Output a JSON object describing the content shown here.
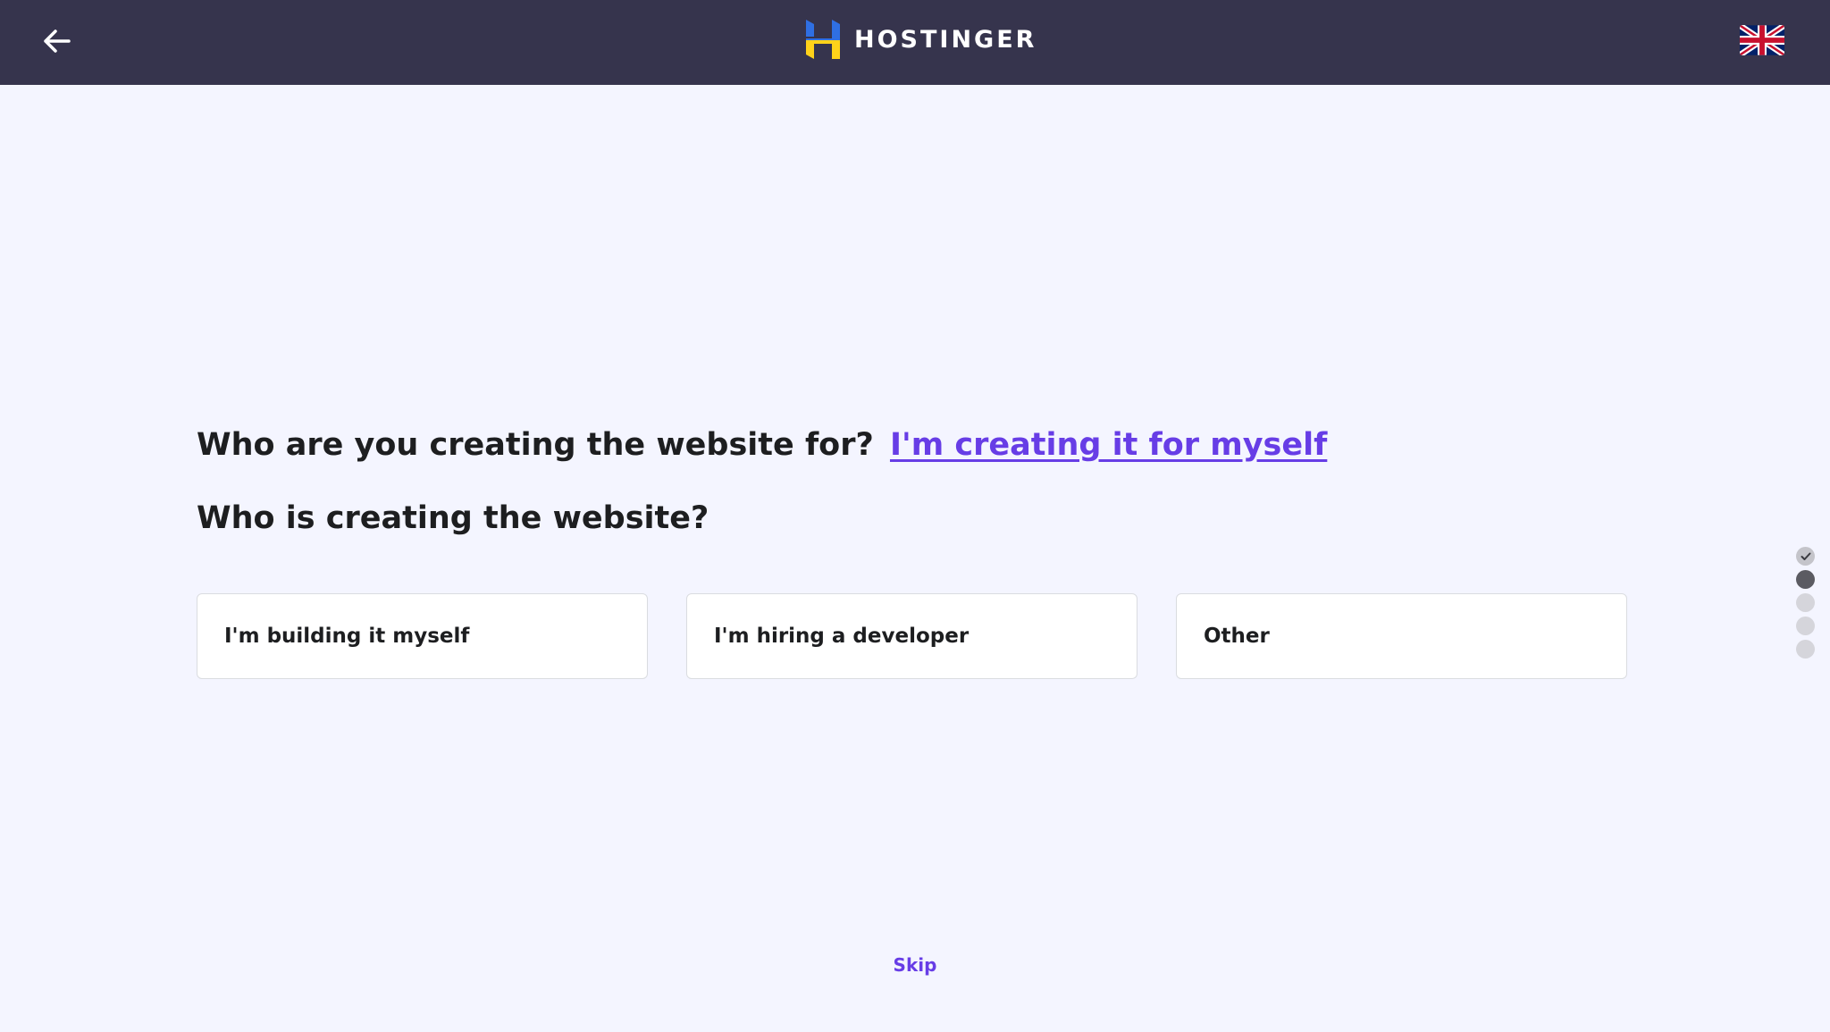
{
  "header": {
    "back_icon": "arrow-left-icon",
    "logo_text": "HOSTINGER",
    "language_icon": "uk-flag-icon"
  },
  "colors": {
    "header_bg": "#36344d",
    "page_bg": "#f4f5ff",
    "accent": "#673de6",
    "text": "#1d1e20"
  },
  "previous_question": {
    "label": "Who are you creating the website for?",
    "answer": "I'm creating it for myself"
  },
  "current_question": {
    "label": "Who is creating the website?",
    "options": [
      {
        "label": "I'm building it myself"
      },
      {
        "label": "I'm hiring a developer"
      },
      {
        "label": "Other"
      }
    ]
  },
  "progress": {
    "total_steps": 5,
    "completed_steps": 1,
    "current_step": 2
  },
  "footer": {
    "skip_label": "Skip"
  }
}
